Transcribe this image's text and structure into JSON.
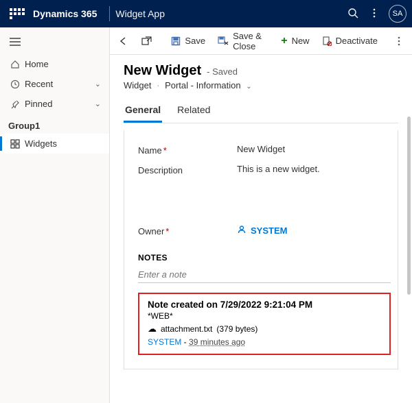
{
  "topbar": {
    "brand": "Dynamics 365",
    "app": "Widget App",
    "avatar": "SA"
  },
  "nav": {
    "home": "Home",
    "recent": "Recent",
    "pinned": "Pinned",
    "group": "Group1",
    "widgets": "Widgets"
  },
  "cmd": {
    "save": "Save",
    "saveClose": "Save & Close",
    "new": "New",
    "deactivate": "Deactivate"
  },
  "head": {
    "title": "New Widget",
    "status": "- Saved",
    "entity": "Widget",
    "form": "Portal - Information"
  },
  "tabs": {
    "general": "General",
    "related": "Related"
  },
  "form": {
    "nameLabel": "Name",
    "nameValue": "New Widget",
    "descLabel": "Description",
    "descValue": "This is a new widget.",
    "ownerLabel": "Owner",
    "ownerValue": "SYSTEM"
  },
  "notes": {
    "header": "NOTES",
    "placeholder": "Enter a note",
    "createdPrefix": "Note created on ",
    "createdTime": "7/29/2022 9:21:04 PM",
    "source": "*WEB*",
    "attachName": "attachment.txt",
    "attachSize": "(379 bytes)",
    "author": "SYSTEM",
    "sep": " - ",
    "ago": "39 minutes ago"
  }
}
